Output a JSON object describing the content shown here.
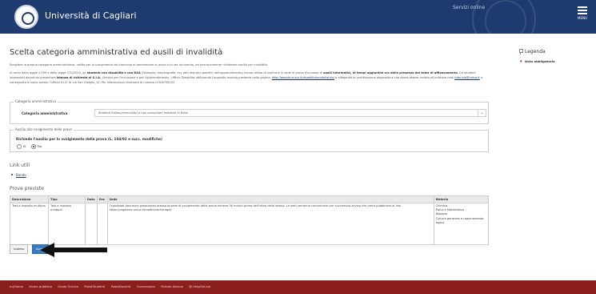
{
  "header": {
    "university": "Università di Cagliari",
    "services": "Servizi online",
    "menu_label": "MENU"
  },
  "page": {
    "title": "Scelta categoria amministrativa ed ausili di invalidità",
    "intro": "Scegliere la propria categoria amministrativa, valida per lo svolgimento del concorso di ammissione al quale ci si sta iscrivendo, ed eventualmente richiedere ausilio per invalidità.",
    "para_1": "Ai sensi della legge 17/99 e della legge 170/2010, gli",
    "para_bold_1": "studenti con disabilità e con DSA",
    "para_2": "(Dislessia, disortografia, ecc altri disturbi specifici dell'apprendimento) hanno diritto di usufruire in sede di prova d'accesso di",
    "para_bold_2": "ausili informatici, di tempi aggiuntivi e/o della presenza del tutor di affiancamento",
    "para_3": ". Gli studenti interessati dovranno presentare",
    "para_bold_3": "istanza di richiesta al S.I.A.",
    "para_4": "(Servizi per l'Inclusione e per l'Apprendimento - Ufficio Disabilità utilizzando l'apposito modulo presente nella pagina:",
    "para_link_1": "http://people.unica.it/disabilita/modulistica/",
    "para_5": "e allegando la certificazione diagnostica che dovrà essere inviata all'indirizzo mail",
    "para_link_2": "tutor.sia@unica.it",
    "para_6": "o consegnata a mano presso l'ufficio S.I.A. di via San Giorgio, 12. Per informazioni chiamare al numero 070/6756222"
  },
  "category": {
    "legend": "Categoria amministrativa",
    "label": "Categoria amministrativa",
    "selected": "Studenti italiani/comunitari e non comunitari residenti in Italia"
  },
  "aid": {
    "legend": "Ausilio allo svolgimento delle prove",
    "question": "Richiede l'ausilio per lo svolgimento della prova (L. 104/92 e succ. modifiche)",
    "option_yes": "Sì",
    "option_no": "No",
    "selected": "No"
  },
  "links": {
    "heading": "Link utili",
    "items": [
      "Bando"
    ]
  },
  "tests": {
    "heading": "Prove previste",
    "columns": [
      "Descrizione",
      "Tipo",
      "Data",
      "Ora",
      "Sede",
      "Materia"
    ],
    "rows": [
      {
        "descrizione": "Test a risposta multipla",
        "tipo": "Test a risposta multipla",
        "data": "",
        "ora": "",
        "sede": "I candidati dovranno presentarsi presso la sede di svolgimento della prova almeno 90 minuti prima dell'inizio della stessa. Le sedi verranno comunicate con successivo avviso che verrà pubblicato al link https://orgsterie.unica.it/medicinachirurgia/",
        "materia": [
          "Chimica",
          "Fisica e Matematica",
          "Biologia",
          "Cultura generale e ragionamento logico"
        ]
      }
    ]
  },
  "buttons": {
    "back": "Indietro",
    "forward": "Avanti"
  },
  "legend_box": {
    "title": "Legenda",
    "required": "Dato obbligatorio"
  },
  "footer": {
    "links": [
      "myHome",
      "Home pubblica",
      "Guida OnLine",
      "PostaStudenti",
      "PostaDocenti",
      "Convenzioni",
      "Portale Ateneo",
      "@ HelpOnLine"
    ]
  },
  "colors": {
    "header_bg": "#1f3a6e",
    "footer_bg": "#8b1e1e",
    "primary_button": "#3a7bbf"
  }
}
